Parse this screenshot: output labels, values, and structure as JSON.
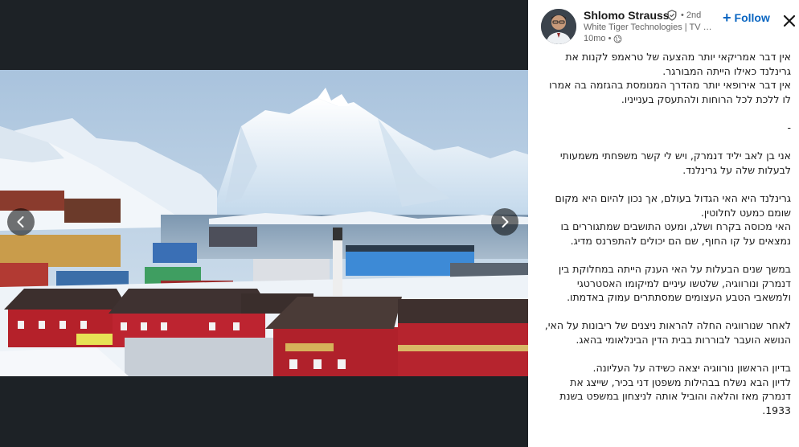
{
  "author": {
    "name": "Shlomo Strauss",
    "degree": "• 2nd",
    "headline": "White Tiger Technologies | TV Ch...",
    "time": "10mo •"
  },
  "actions": {
    "follow_label": "Follow",
    "follow_icon": "plus-icon",
    "close_icon": "close-icon"
  },
  "media": {
    "prev_icon": "chevron-left-icon",
    "next_icon": "chevron-right-icon"
  },
  "post": {
    "paragraphs": [
      [
        "אין דבר אמריקאי יותר מהצעה של טראמפ לקנות את",
        "גרינלנד כאילו הייתה המבורגר.",
        "אין דבר אירופאי יותר מהדרך המנומסת בהגזמה בה אמרו",
        "לו ללכת לכל הרוחות ולהתעסק בענייניו."
      ],
      [
        "-"
      ],
      [
        "אני בן לאב יליד דנמרק, ויש לי קשר משפחתי משמעותי",
        "לבעלות שלה על גרינלנד."
      ],
      [
        "גרינלנד היא האי הגדול בעולם, אך נכון להיום היא מקום",
        "שומם כמעט לחלוטין.",
        "האי מכוסה בקרח ושלג, ומעט התושבים שמתגוררים בו",
        "נמצאים על קו החוף, שם הם יכולים להתפרנס מדיג."
      ],
      [
        "במשך שנים הבעלות על האי הענק הייתה במחלוקת בין",
        "דנמרק ונורווגיה, שלטשו עיניים למיקומו האסטרטגי",
        "ולמשאבי הטבע העצומים שמסתתרים עמוק באדמתו."
      ],
      [
        "לאחר שנורווגיה החלה להראות ניצנים של ריבונות על האי,",
        "הנושא הועבר לבוררות בבית הדין הבינלאומי בהאג."
      ],
      [
        "בדיון הראשון נורווגיה יצאה כשידה על העליונה.",
        "לדיון הבא נשלח בבהילות משפטן דני בכיר, שייצג את",
        "דנמרק מאז והלאה והוביל אותה לניצחון במשפט בשנת",
        "1933."
      ]
    ]
  },
  "colors": {
    "accent": "#0a66c2",
    "media_background": "#1d2226",
    "text": "#191919",
    "muted": "#666666"
  }
}
